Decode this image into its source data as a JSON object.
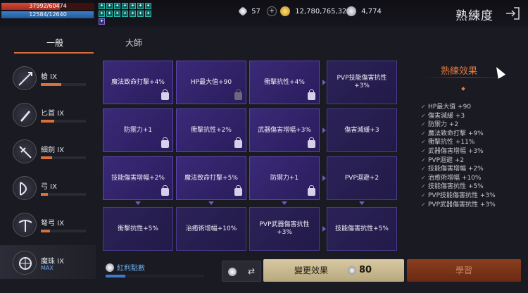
{
  "status": {
    "hp_text": "37992/60474",
    "hp_fraction": 0.628,
    "mp_text": "12584/12640",
    "mp_fraction": 0.995
  },
  "currency": {
    "diamond": "57",
    "gold": "12,780,765,327",
    "gem": "4,774",
    "plus_label": "+"
  },
  "page": {
    "title": "熟練度",
    "exit_icon": "exit-icon"
  },
  "tabs": [
    {
      "label": "一般"
    },
    {
      "label": "大師"
    }
  ],
  "weapons": [
    {
      "name": "槍 IX",
      "progress": 0.45
    },
    {
      "name": "匕首 IX",
      "progress": 0.3
    },
    {
      "name": "細劍 IX",
      "progress": 0.25
    },
    {
      "name": "弓 IX",
      "progress": 0.15
    },
    {
      "name": "弩弓 IX",
      "progress": 0.2
    },
    {
      "name": "魔珠 IX",
      "max": "MAX"
    }
  ],
  "nodes": [
    {
      "label": "魔法致命打擊+4%",
      "lock": "light"
    },
    {
      "label": "HP最大值+90",
      "lock": "dark"
    },
    {
      "label": "衝擊抗性+4%",
      "lock": "light"
    },
    {
      "label": "PVP技能傷害抗性+3%",
      "lock": ""
    },
    {
      "label": "防禦力+1",
      "lock": "light"
    },
    {
      "label": "衝擊抗性+2%",
      "lock": "light"
    },
    {
      "label": "武器傷害增幅+3%",
      "lock": "light"
    },
    {
      "label": "傷害減緩+3",
      "lock": ""
    },
    {
      "label": "技能傷害增幅+2%",
      "lock": "light"
    },
    {
      "label": "魔法致命打擊+5%",
      "lock": "light"
    },
    {
      "label": "防禦力+1",
      "lock": "light"
    },
    {
      "label": "PVP迴避+2",
      "lock": ""
    },
    {
      "label": "衝擊抗性+5%",
      "lock": ""
    },
    {
      "label": "治癒術增幅+10%",
      "lock": ""
    },
    {
      "label": "PVP武器傷害抗性+3%",
      "lock": ""
    },
    {
      "label": "技能傷害抗性+5%",
      "lock": ""
    }
  ],
  "effects": {
    "title": "熟練效果",
    "items": [
      "HP最大值 +90",
      "傷害減緩 +3",
      "防禦力 +2",
      "魔法致命打擊 +9%",
      "衝擊抗性 +11%",
      "武器傷害增幅 +3%",
      "PVP迴避 +2",
      "技能傷害增幅 +2%",
      "治癒術增幅 +10%",
      "技能傷害抗性 +5%",
      "PVP技能傷害抗性 +3%",
      "PVP武器傷害抗性 +3%"
    ]
  },
  "bottom": {
    "bonus_label": "紅利點數",
    "bonus_fraction": 0.2,
    "swap_icon": "⇄",
    "change_label": "變更效果",
    "change_cost": "80",
    "confirm_label": "學習"
  },
  "colors": {
    "accent": "#e07a3e",
    "node": "#3a2a78",
    "bonus": "#6ab0f0"
  }
}
